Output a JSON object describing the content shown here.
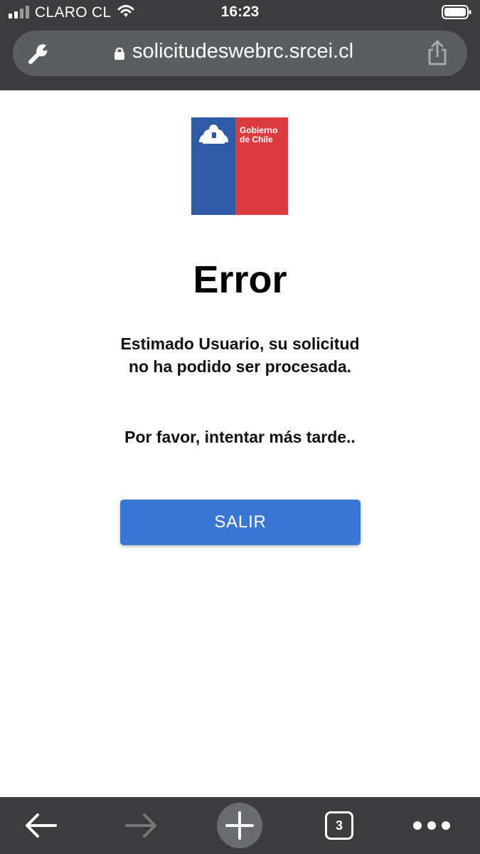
{
  "status_bar": {
    "carrier": "CLARO CL",
    "time": "16:23"
  },
  "browser": {
    "url": "solicitudeswebrc.srcei.cl",
    "tab_count": "3"
  },
  "logo": {
    "line1": "Gobierno",
    "line2": "de Chile"
  },
  "page": {
    "title": "Error",
    "message": "Estimado Usuario, su solicitud no ha podido ser procesada.",
    "retry_message": "Por favor, intentar más tarde..",
    "exit_button": "SALIR"
  },
  "colors": {
    "chrome": "#3c3c3e",
    "address_bar": "#5b5d61",
    "button": "#3a76d4",
    "logo_blue": "#2f5aa8",
    "logo_red": "#dc3b41"
  },
  "icons": [
    "cellular-signal-icon",
    "wifi-icon",
    "battery-icon",
    "wrench-icon",
    "lock-icon",
    "share-icon",
    "back-arrow-icon",
    "forward-arrow-icon",
    "plus-icon",
    "more-icon"
  ]
}
